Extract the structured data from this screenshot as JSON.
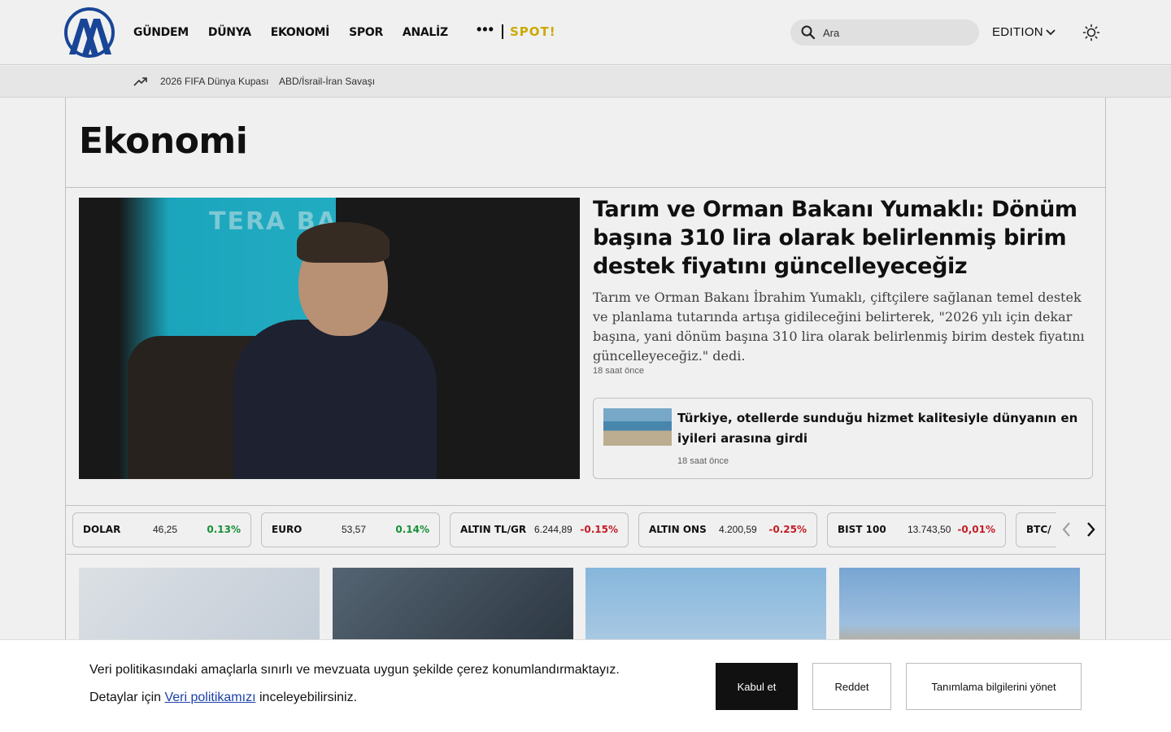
{
  "header": {
    "nav": [
      "GÜNDEM",
      "DÜNYA",
      "EKONOMİ",
      "SPOR",
      "ANALİZ"
    ],
    "more": "•••",
    "spot_logo": "SPOT!",
    "search_placeholder": "Ara",
    "edition_label": "EDITION"
  },
  "trending": {
    "items": [
      "2026 FIFA Dünya Kupası",
      "ABD/İsrail-İran Savaşı"
    ]
  },
  "page": {
    "title": "Ekonomi"
  },
  "hero": {
    "image_sign_text": "TERA BA",
    "title": "Tarım ve Orman Bakanı Yumaklı: Dönüm başına 310 lira olarak belirlenmiş birim destek fiyatını güncelleyeceğiz",
    "description": "Tarım ve Orman Bakanı İbrahim Yumaklı, çiftçilere sağlanan temel destek ve planlama tutarında artışa gidileceğini belirterek, \"2026 yılı için dekar başına, yani dönüm başına 310 lira olarak belirlenmiş birim destek fiyatını güncelleyeceğiz.\" dedi.",
    "time": "18 saat önce"
  },
  "side_card": {
    "title": "Türkiye, otellerde sunduğu hizmet kalitesiyle dünyanın en iyileri arasına girdi",
    "time": "18 saat önce"
  },
  "markets": [
    {
      "name": "DOLAR",
      "value": "46,25",
      "change": "0.13%",
      "dir": "up"
    },
    {
      "name": "EURO",
      "value": "53,57",
      "change": "0.14%",
      "dir": "up"
    },
    {
      "name": "ALTIN TL/GR",
      "value": "6.244,89",
      "change": "-0.15%",
      "dir": "down"
    },
    {
      "name": "ALTIN ONS",
      "value": "4.200,59",
      "change": "-0.25%",
      "dir": "down"
    },
    {
      "name": "BIST 100",
      "value": "13.743,50",
      "change": "-0,01%",
      "dir": "down"
    },
    {
      "name": "BTC/",
      "value": "",
      "change": "",
      "dir": "up"
    }
  ],
  "cookie": {
    "line1": "Veri politikasındaki amaçlarla sınırlı ve mevzuata uygun şekilde çerez konumlandırmaktayız.",
    "line2_prefix": "Detaylar için",
    "line2_link": "Veri politikamızı",
    "line2_suffix": "inceleyebilirsiniz.",
    "accept": "Kabul et",
    "reject": "Reddet",
    "manage": "Tanımlama bilgilerini yönet"
  },
  "colors": {
    "up": "#1a9a3a",
    "down": "#d0202a",
    "brand_blue": "#1a4aa0",
    "spot_yellow": "#d8b400"
  }
}
